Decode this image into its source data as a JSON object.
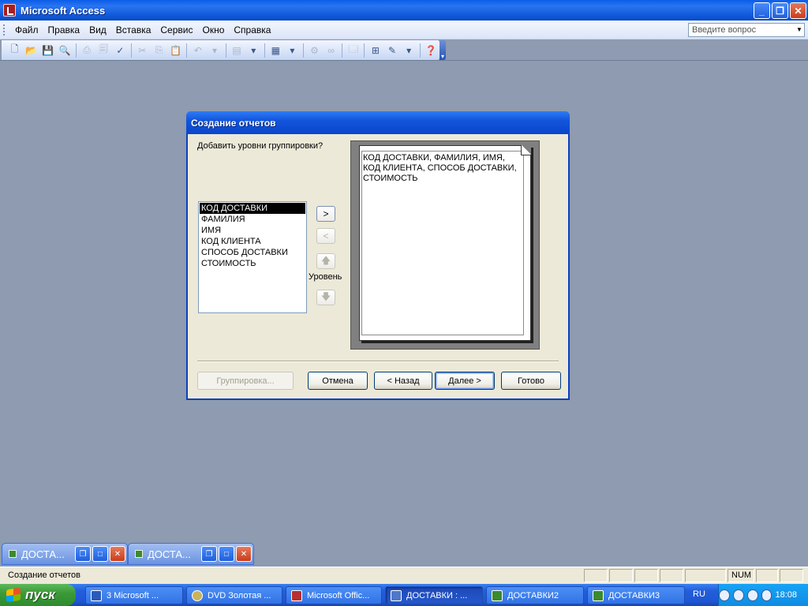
{
  "window": {
    "title": "Microsoft Access"
  },
  "menu": [
    "Файл",
    "Правка",
    "Вид",
    "Вставка",
    "Сервис",
    "Окно",
    "Справка"
  ],
  "help": {
    "placeholder": "Введите вопрос"
  },
  "dialog": {
    "title": "Создание отчетов",
    "prompt": "Добавить уровни группировки?",
    "fields": [
      "КОД ДОСТАВКИ",
      "ФАМИЛИЯ",
      "ИМЯ",
      "КОД КЛИЕНТА",
      "СПОСОБ ДОСТАВКИ",
      "СТОИМОСТЬ"
    ],
    "selected_field": "КОД ДОСТАВКИ",
    "add_label": ">",
    "remove_label": "<",
    "level_label": "Уровень",
    "preview_text": "КОД ДОСТАВКИ, ФАМИЛИЯ, ИМЯ, КОД КЛИЕНТА, СПОСОБ ДОСТАВКИ, СТОИМОСТЬ",
    "buttons": {
      "grouping": "Группировка...",
      "cancel": "Отмена",
      "back": "< Назад",
      "next": "Далее >",
      "finish": "Готово"
    }
  },
  "minimized": [
    {
      "title": "ДОСТА..."
    },
    {
      "title": "ДОСТА..."
    }
  ],
  "status": {
    "text": "Создание отчетов",
    "num": "NUM"
  },
  "taskbar": {
    "start": "пуск",
    "items": [
      {
        "label": "3 Microsoft ...",
        "icon": "word-icon"
      },
      {
        "label": "DVD  Золотая ...",
        "icon": "dvd-icon"
      },
      {
        "label": "Microsoft Offic...",
        "icon": "office-icon"
      },
      {
        "label": "ДОСТАВКИ : ...",
        "icon": "access-table-icon"
      },
      {
        "label": "ДОСТАВКИ2",
        "icon": "access-table-icon"
      },
      {
        "label": "ДОСТАВКИ3",
        "icon": "access-table-icon"
      }
    ],
    "lang": "RU",
    "clock": "18:08"
  },
  "colors": {
    "titlebar": "#0a5ee8",
    "desktop": "#8e9bb0",
    "dialog": "#ece9d8"
  }
}
